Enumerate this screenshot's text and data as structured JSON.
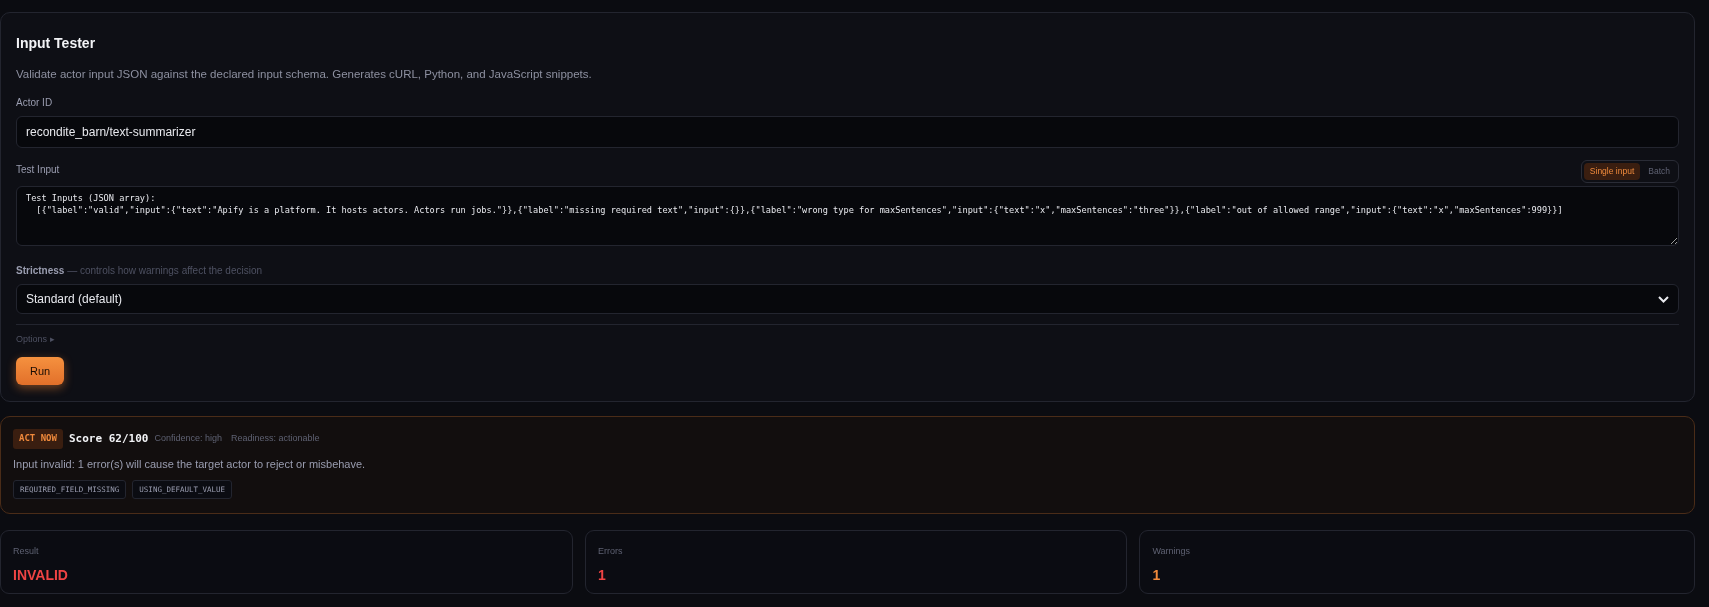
{
  "panel": {
    "title": "Input Tester",
    "description": "Validate actor input JSON against the declared input schema. Generates cURL, Python, and JavaScript snippets.",
    "actor_id": {
      "label": "Actor ID",
      "value": "recondite_barn/text-summarizer"
    },
    "test_input": {
      "label": "Test Input",
      "modes": [
        {
          "label": "Single input",
          "selected": true
        },
        {
          "label": "Batch",
          "selected": false
        }
      ],
      "value": "Test Inputs (JSON array):\n  [{\"label\":\"valid\",\"input\":{\"text\":\"Apify is a platform. It hosts actors. Actors run jobs.\"}},{\"label\":\"missing required text\",\"input\":{}},{\"label\":\"wrong type for maxSentences\",\"input\":{\"text\":\"x\",\"maxSentences\":\"three\"}},{\"label\":\"out of allowed range\",\"input\":{\"text\":\"x\",\"maxSentences\":999}}]"
    },
    "strictness": {
      "label": "Strictness",
      "hint": "— controls how warnings affect the decision",
      "value": "Standard (default)"
    },
    "options": {
      "label": "Options",
      "marker": "▸",
      "expanded": false
    },
    "run_button": "Run"
  },
  "verdict": {
    "badge": "ACT NOW",
    "score": "Score 62/100",
    "confidence": "Confidence: high",
    "readiness": "Readiness: actionable",
    "message": "Input invalid: 1 error(s) will cause the target actor to reject or misbehave.",
    "codes": [
      "REQUIRED_FIELD_MISSING",
      "USING_DEFAULT_VALUE"
    ]
  },
  "stats": [
    {
      "label": "Result",
      "value": "INVALID",
      "color": "#ef4444"
    },
    {
      "label": "Errors",
      "value": "1",
      "color": "#ef4444"
    },
    {
      "label": "Warnings",
      "value": "1",
      "color": "#f08a3c"
    }
  ]
}
